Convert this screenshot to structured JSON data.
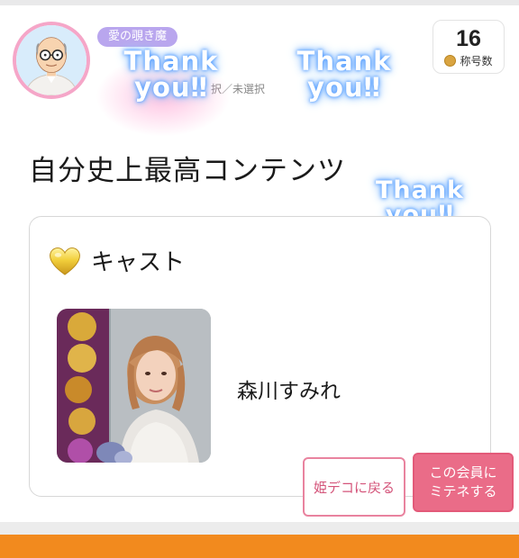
{
  "profile": {
    "avatar_icon": "bald-man-with-glasses-icon",
    "title_badge": "愛の覗き魔",
    "selection_status": "択／未選択",
    "count_value": "16",
    "count_label": "称号数",
    "coin_icon": "coin-icon"
  },
  "overlay": {
    "thank_line1": "Thank",
    "thank_line2": "you",
    "thank_heart": "‼",
    "glow_color": "#5aa0ff"
  },
  "section": {
    "title": "自分史上最高コンテンツ"
  },
  "card": {
    "icon": "gold-heart-icon",
    "label": "キャスト",
    "cast_name": "森川すみれ"
  },
  "actions": {
    "back_label": "姫デコに戻る",
    "mitene_line1": "この会員に",
    "mitene_line2": "ミテネする"
  },
  "colors": {
    "accent_pink": "#ea6c88",
    "badge_purple": "#b9a6ee",
    "bottom_bar": "#f28a1e"
  }
}
